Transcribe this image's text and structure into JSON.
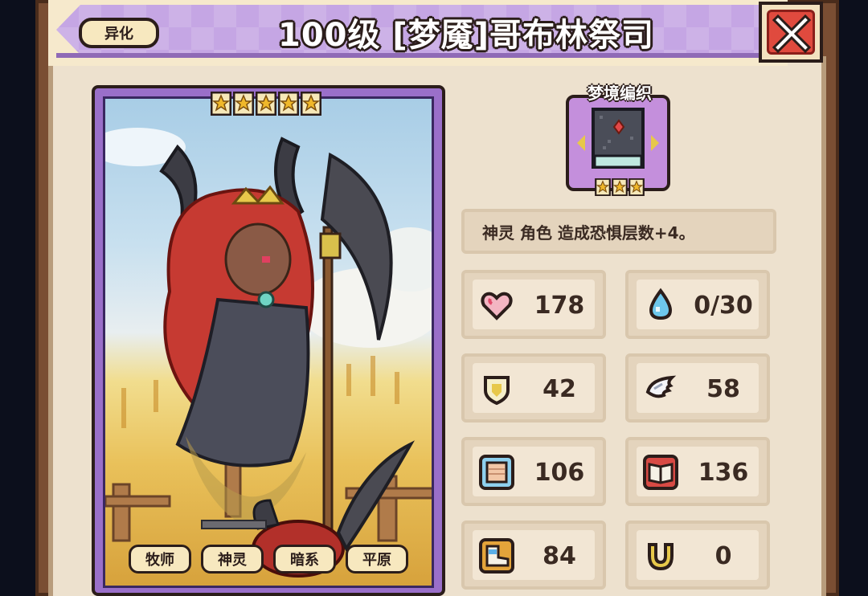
{
  "title": "100级 [梦魇]哥布林祭司",
  "mutation_button": "异化",
  "close_button": "close",
  "character": {
    "rarity_stars": 5,
    "tags": [
      "牧师",
      "神灵",
      "暗系",
      "平原"
    ]
  },
  "equipment": {
    "label": "梦境编织",
    "stars": 3,
    "icon": "spellbook-icon"
  },
  "description": "神灵 角色 造成恐惧层数+4。",
  "stats": [
    {
      "name": "health",
      "icon": "heart-icon",
      "value": "178"
    },
    {
      "name": "mana",
      "icon": "water-drop-icon",
      "value": "0/30"
    },
    {
      "name": "defense",
      "icon": "shield-icon",
      "value": "42"
    },
    {
      "name": "speed",
      "icon": "wing-icon",
      "value": "58"
    },
    {
      "name": "attack",
      "icon": "fist-icon",
      "value": "106"
    },
    {
      "name": "magic",
      "icon": "book-icon",
      "value": "136"
    },
    {
      "name": "resistance",
      "icon": "boot-icon",
      "value": "84"
    },
    {
      "name": "luck",
      "icon": "horseshoe-icon",
      "value": "0"
    }
  ],
  "colors": {
    "frame": "#7a4e33",
    "panel": "#ede1ce",
    "card": "#9a6fc9",
    "close_red": "#e04a3e",
    "ribbon": "#c5a6e4"
  }
}
